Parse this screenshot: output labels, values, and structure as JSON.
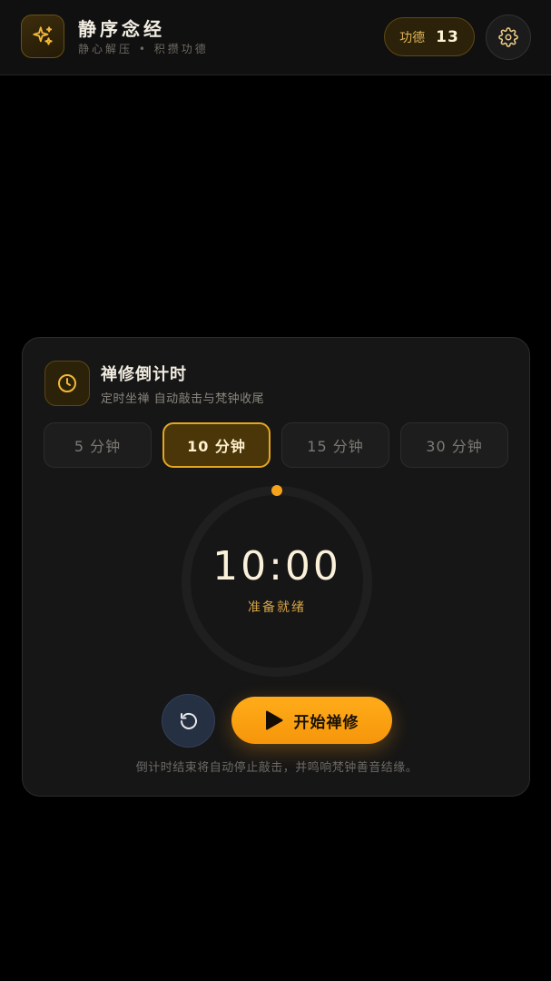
{
  "header": {
    "title": "静序念经",
    "subtitle": "静心解压  •  积攒功德",
    "merit_label": "功德",
    "merit_count": "13",
    "logo_icon": "sparkles-icon",
    "settings_icon": "gear-icon"
  },
  "card": {
    "title": "禅修倒计时",
    "subtitle": "定时坐禅 自动敲击与梵钟收尾",
    "icon": "clock-icon",
    "durations": [
      {
        "label": "5 分钟",
        "selected": false
      },
      {
        "label": "10 分钟",
        "selected": true
      },
      {
        "label": "15 分钟",
        "selected": false
      },
      {
        "label": "30 分钟",
        "selected": false
      }
    ],
    "timer": {
      "display": "10:00",
      "status": "准备就绪",
      "progress": 0
    },
    "reset_icon": "reset-icon",
    "start_label": "开始禅修",
    "start_icon": "play-icon",
    "footnote": "倒计时结束将自动停止敲击，并鸣响梵钟善音结缘。"
  },
  "colors": {
    "accent": "#f6a21b",
    "accent_dark": "#4a3608",
    "background": "#000000",
    "card": "#161616",
    "reset_button": "#253042"
  }
}
